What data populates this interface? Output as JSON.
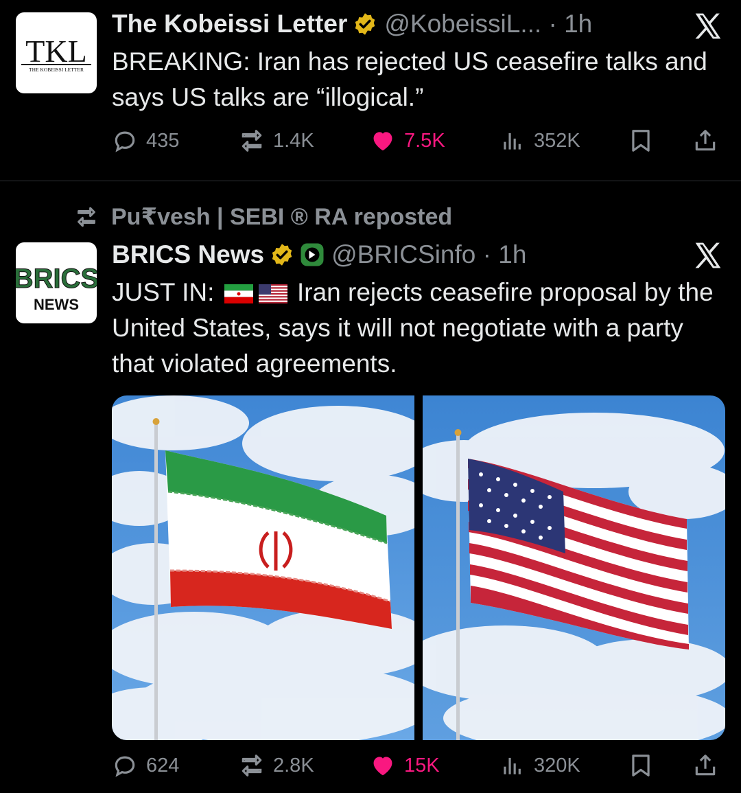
{
  "tweet1": {
    "avatar": {
      "initials": "TKL",
      "subtitle": "THE KOBEISSI LETTER"
    },
    "author_name": "The Kobeissi Letter",
    "handle_time": "@KobeissiL... · 1h",
    "text": "BREAKING: Iran has rejected US ceasefire talks and says US talks are “illogical.”",
    "replies": "435",
    "reposts": "1.4K",
    "likes": "7.5K",
    "views": "352K"
  },
  "repost_banner": {
    "text": "Pu₹vesh | SEBI ® RA reposted"
  },
  "tweet2": {
    "avatar": {
      "line1": "BRICS",
      "line2": "NEWS"
    },
    "author_name": "BRICS News",
    "handle_time": "@BRICSinfo · 1h",
    "text_prefix": "JUST IN:",
    "text_main": "Iran rejects ceasefire proposal by the United States, says it will not negotiate with a party that violated agreements.",
    "replies": "624",
    "reposts": "2.8K",
    "likes": "15K",
    "views": "320K"
  },
  "colors": {
    "background": "#000000",
    "text": "#e7e9ea",
    "muted": "#8b9096",
    "like": "#f91880",
    "verified": "#e2b719"
  },
  "icons": [
    "x-logo-icon",
    "verified-badge-icon",
    "reply-icon",
    "repost-icon",
    "heart-icon",
    "views-icon",
    "bookmark-icon",
    "share-icon"
  ]
}
